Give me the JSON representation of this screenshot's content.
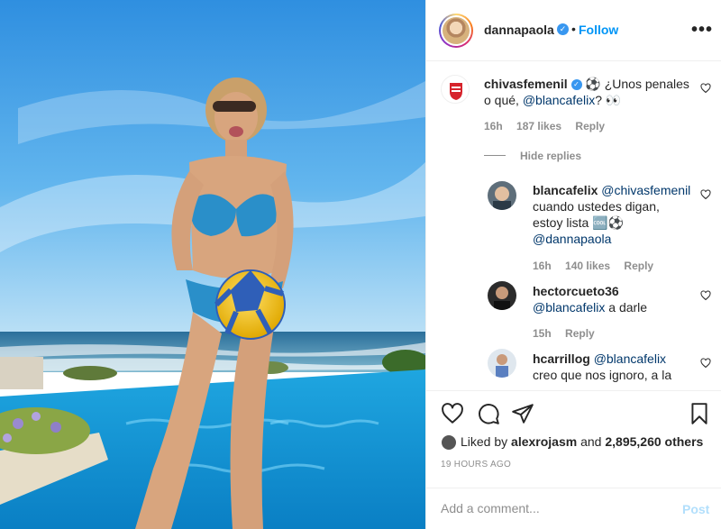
{
  "post": {
    "author": "dannapaola",
    "follow_label": "Follow",
    "separator": "•",
    "more_label": "•••"
  },
  "comments": [
    {
      "user": "chivasfemenil",
      "text_before": " ⚽ ¿Unos penales o qué, ",
      "mention": "@blancafelix",
      "text_after": "? 👀",
      "time": "16h",
      "likes": "187 likes",
      "reply": "Reply",
      "hide_replies": "Hide replies"
    },
    {
      "user": "blancafelix",
      "mention1": "@chivasfemenil",
      "text": " cuando ustedes digan, estoy lista 🆒⚽ ",
      "mention2": "@dannapaola",
      "time": "16h",
      "likes": "140 likes",
      "reply": "Reply"
    },
    {
      "user": "hectorcueto36",
      "mention": "@blancafelix",
      "text": " a darle",
      "time": "15h",
      "reply": "Reply"
    },
    {
      "user": "hcarrillog",
      "mention": "@blancafelix",
      "text": " creo que nos ignoro, a la"
    }
  ],
  "likes_summary": {
    "prefix": "Liked by ",
    "user": "alexrojasm",
    "middle": " and ",
    "count": "2,895,260 others"
  },
  "timestamp": "19 HOURS AGO",
  "comment_box": {
    "placeholder": "Add a comment...",
    "post_label": "Post"
  },
  "colors": {
    "link_blue": "#0095f6",
    "verified_blue": "#3897f0",
    "muted": "#8e8e8e",
    "post_disabled": "#b2dffc"
  },
  "icons": [
    "verified-badge-icon",
    "more-options-icon",
    "heart-icon",
    "comment-icon",
    "share-icon",
    "bookmark-icon"
  ]
}
